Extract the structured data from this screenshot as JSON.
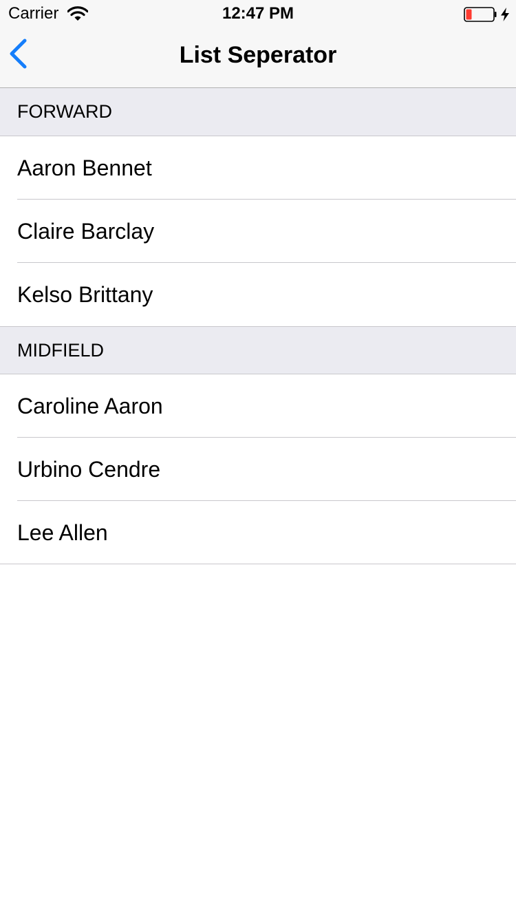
{
  "status_bar": {
    "carrier": "Carrier",
    "time": "12:47 PM",
    "icons": [
      "wifi-icon",
      "battery-low-icon",
      "charging-bolt-icon"
    ]
  },
  "nav": {
    "title": "List Seperator",
    "back_icon": "chevron-left-icon",
    "accent_color": "#157efb"
  },
  "sections": [
    {
      "header": "FORWARD",
      "items": [
        "Aaron Bennet",
        "Claire Barclay",
        "Kelso Brittany"
      ]
    },
    {
      "header": "MIDFIELD",
      "items": [
        "Caroline Aaron",
        "Urbino Cendre",
        "Lee Allen"
      ]
    }
  ]
}
